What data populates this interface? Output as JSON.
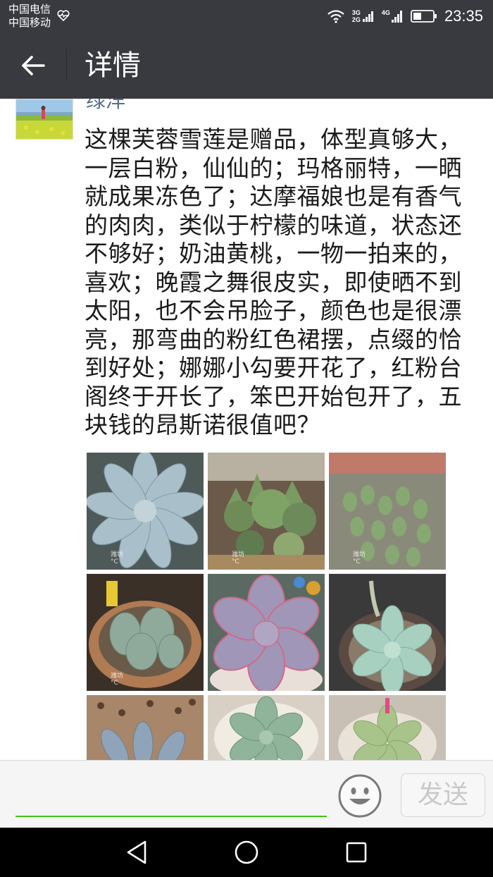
{
  "status_bar": {
    "carrier_1": "中国电信",
    "carrier_2": "中国移动",
    "net_label_top": "3G",
    "net_label_bottom": "2G",
    "net_label_4g": "4G",
    "time": "23:35"
  },
  "header": {
    "title": "详情"
  },
  "post": {
    "username": "绿洋",
    "text": "这棵芙蓉雪莲是赠品，体型真够大，一层白粉，仙仙的；玛格丽特，一晒就成果冻色了；达摩福娘也是有香气的肉肉，类似于柠檬的味道，状态还不够好；奶油黄桃，一物一拍来的，喜欢；晚霞之舞很皮实，即使晒不到太阳，也不会吊脸子，颜色也是很漂亮，那弯曲的粉红色裙摆，点缀的恰到好处；娜娜小勾要开花了，红粉台阁终于开长了，笨巴开始包开了，五块钱的昂斯诺很值吧？",
    "photo_watermarks": [
      "潍坊",
      "潍坊",
      "潍坊",
      "潍坊"
    ],
    "photo_temps": [
      "°C",
      "°C",
      "°C",
      "°C"
    ]
  },
  "comment_bar": {
    "input_value": "",
    "send_label": "发送"
  },
  "colors": {
    "header_bg": "#393a3f",
    "username": "#576b95",
    "input_accent": "#45c01a",
    "send_disabled": "#c9c9c9"
  },
  "icons": [
    "heart-rate-icon",
    "wifi-icon",
    "signal-icon",
    "battery-icon",
    "back-arrow-icon",
    "emoji-icon",
    "nav-back-icon",
    "nav-home-icon",
    "nav-recents-icon"
  ]
}
